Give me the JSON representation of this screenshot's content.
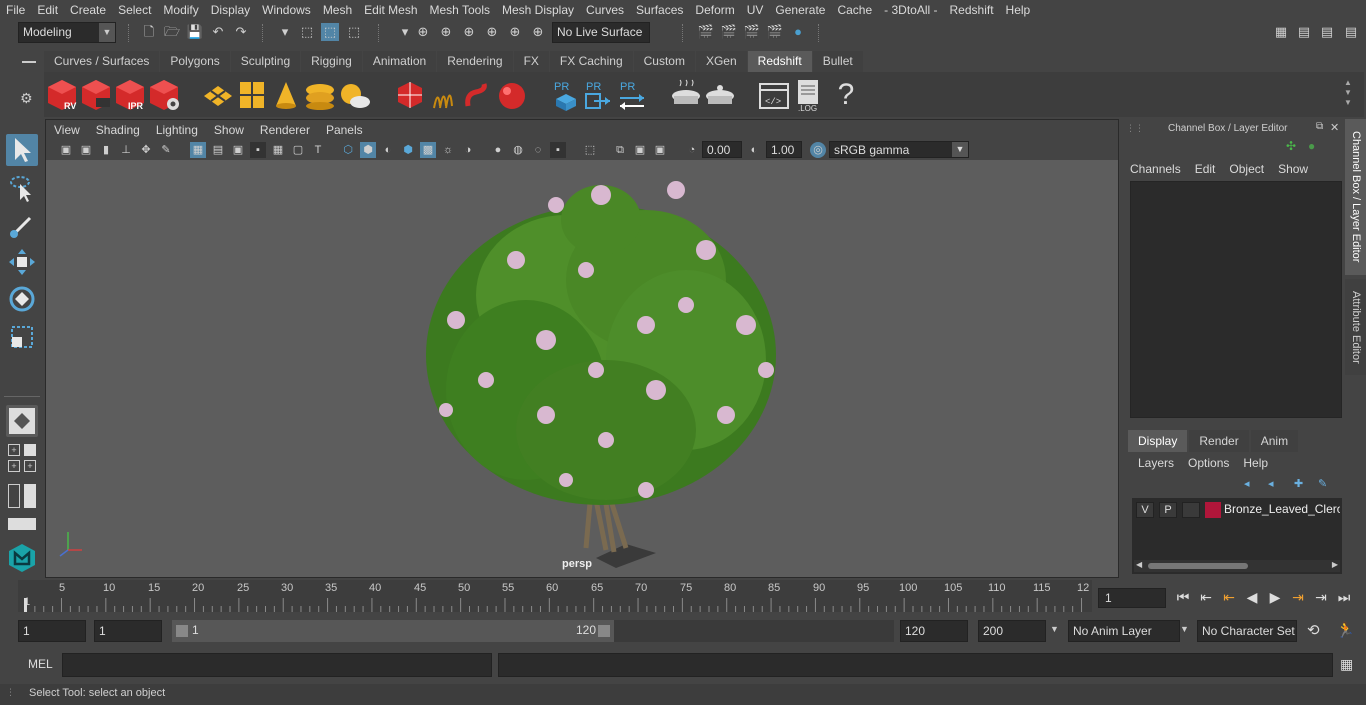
{
  "menubar": [
    "File",
    "Edit",
    "Create",
    "Select",
    "Modify",
    "Display",
    "Windows",
    "Mesh",
    "Edit Mesh",
    "Mesh Tools",
    "Mesh Display",
    "Curves",
    "Surfaces",
    "Deform",
    "UV",
    "Generate",
    "Cache",
    "- 3DtoAll -",
    "Redshift",
    "Help"
  ],
  "statusline": {
    "mode": "Modeling",
    "live_surface": "No Live Surface"
  },
  "shelf_tabs": [
    "Curves / Surfaces",
    "Polygons",
    "Sculpting",
    "Rigging",
    "Animation",
    "Rendering",
    "FX",
    "FX Caching",
    "Custom",
    "XGen",
    "Redshift",
    "Bullet"
  ],
  "shelf_active": "Redshift",
  "shelf_labels": {
    "rv": "RV",
    "ipr": "IPR",
    "pr1": "PR",
    "pr2": "PR",
    "pr3": "PR",
    "log": ".LOG",
    "help": "?"
  },
  "viewport": {
    "menu": [
      "View",
      "Shading",
      "Lighting",
      "Show",
      "Renderer",
      "Panels"
    ],
    "exposure": "0.00",
    "gamma": "1.00",
    "colorspace": "sRGB gamma",
    "camera_label": "persp"
  },
  "right_panel": {
    "title": "Channel Box / Layer Editor",
    "menu": [
      "Channels",
      "Edit",
      "Object",
      "Show"
    ],
    "display_tabs": [
      "Display",
      "Render",
      "Anim"
    ],
    "display_menu": [
      "Layers",
      "Options",
      "Help"
    ],
    "layer": {
      "v": "V",
      "p": "P",
      "name": "Bronze_Leaved_Clerod",
      "color": "#b0163a"
    },
    "side_tabs": [
      "Channel Box / Layer Editor",
      "Attribute Editor"
    ]
  },
  "timeline": {
    "ticks": [
      "1",
      "5",
      "10",
      "15",
      "20",
      "25",
      "30",
      "35",
      "40",
      "45",
      "50",
      "55",
      "60",
      "65",
      "70",
      "75",
      "80",
      "85",
      "90",
      "95",
      "100",
      "105",
      "110",
      "115",
      "12"
    ],
    "current_frame": "1"
  },
  "range": {
    "start": "1",
    "inner_start": "1",
    "slider_start": "1",
    "slider_end": "120",
    "end": "120",
    "total": "200",
    "anim_layer": "No Anim Layer",
    "char_set": "No Character Set"
  },
  "cmd": {
    "label": "MEL"
  },
  "help_line": "Select Tool: select an object",
  "colors": {
    "accent": "#5285a6",
    "redshift_red": "#d42a2a",
    "yellow": "#f0b428"
  }
}
